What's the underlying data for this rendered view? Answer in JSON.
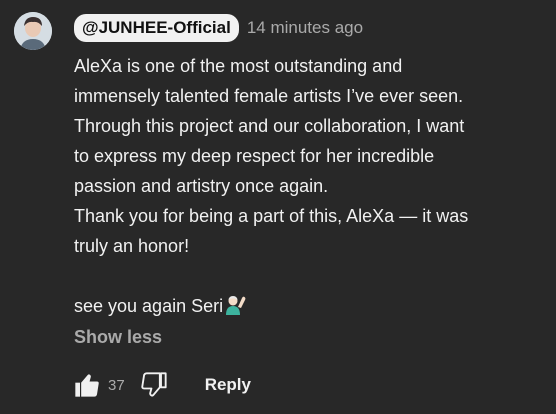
{
  "comment": {
    "author_handle": "@JUNHEE-Official",
    "timestamp": "14 minutes ago",
    "lines": [
      "AleXa is one of the most outstanding and",
      "immensely talented female artists I’ve ever seen.",
      "Through this project and our collaboration, I want",
      "to express my deep respect for her incredible",
      "passion and artistry once again.",
      "Thank you for being a part of this, AleXa — it was",
      "truly an honor!"
    ],
    "signoff": "see you again Seri",
    "signoff_emoji": "person-raising-hand-emoji",
    "show_less_label": "Show less",
    "like_count": "37",
    "reply_label": "Reply"
  },
  "icons": {
    "like": "thumbs-up-icon",
    "dislike": "thumbs-down-icon",
    "avatar": "avatar"
  },
  "colors": {
    "background": "#282828",
    "text": "#f1f1f1",
    "muted": "#aaaaaa",
    "handle_badge": "#f1f1f1"
  }
}
